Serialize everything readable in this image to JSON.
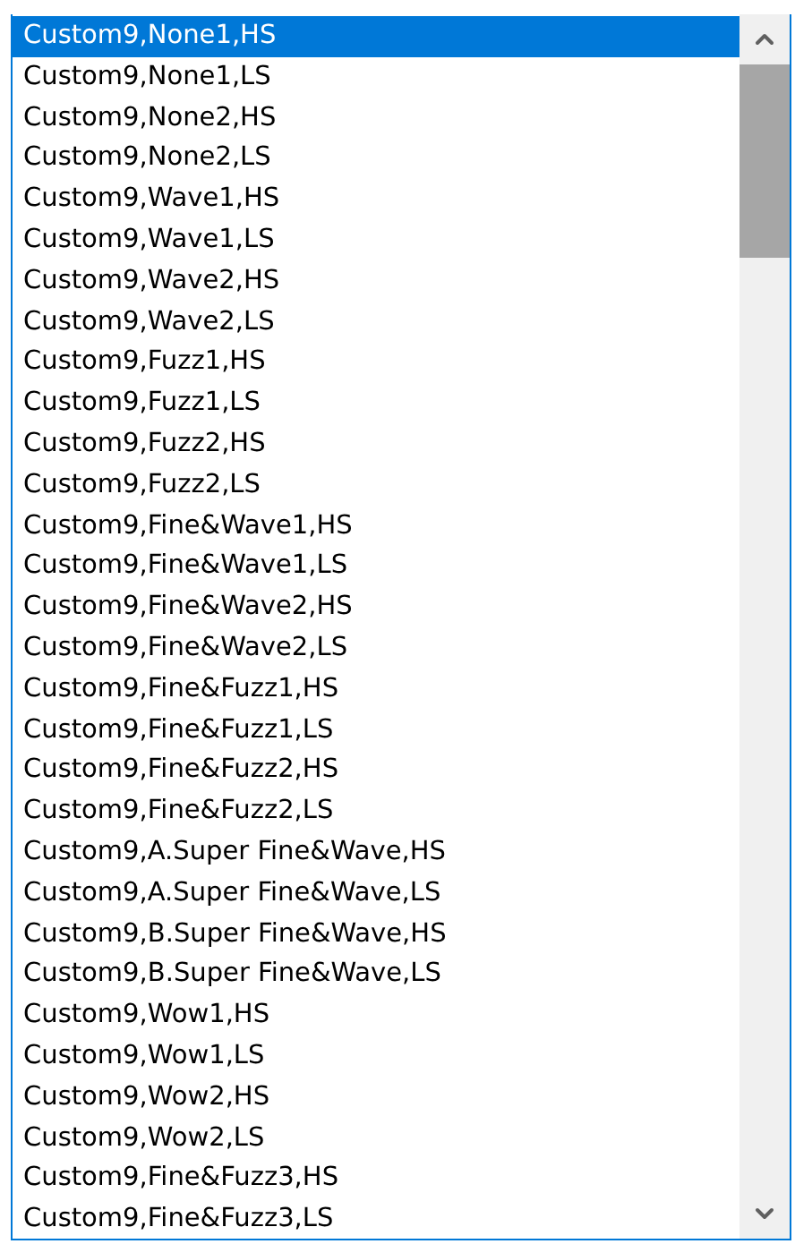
{
  "list": {
    "items": [
      {
        "label": "Custom9,None1,HS",
        "selected": true
      },
      {
        "label": "Custom9,None1,LS",
        "selected": false
      },
      {
        "label": "Custom9,None2,HS",
        "selected": false
      },
      {
        "label": "Custom9,None2,LS",
        "selected": false
      },
      {
        "label": "Custom9,Wave1,HS",
        "selected": false
      },
      {
        "label": "Custom9,Wave1,LS",
        "selected": false
      },
      {
        "label": "Custom9,Wave2,HS",
        "selected": false
      },
      {
        "label": "Custom9,Wave2,LS",
        "selected": false
      },
      {
        "label": "Custom9,Fuzz1,HS",
        "selected": false
      },
      {
        "label": "Custom9,Fuzz1,LS",
        "selected": false
      },
      {
        "label": "Custom9,Fuzz2,HS",
        "selected": false
      },
      {
        "label": "Custom9,Fuzz2,LS",
        "selected": false
      },
      {
        "label": "Custom9,Fine&Wave1,HS",
        "selected": false
      },
      {
        "label": "Custom9,Fine&Wave1,LS",
        "selected": false
      },
      {
        "label": "Custom9,Fine&Wave2,HS",
        "selected": false
      },
      {
        "label": "Custom9,Fine&Wave2,LS",
        "selected": false
      },
      {
        "label": "Custom9,Fine&Fuzz1,HS",
        "selected": false
      },
      {
        "label": "Custom9,Fine&Fuzz1,LS",
        "selected": false
      },
      {
        "label": "Custom9,Fine&Fuzz2,HS",
        "selected": false
      },
      {
        "label": "Custom9,Fine&Fuzz2,LS",
        "selected": false
      },
      {
        "label": "Custom9,A.Super Fine&Wave,HS",
        "selected": false
      },
      {
        "label": "Custom9,A.Super Fine&Wave,LS",
        "selected": false
      },
      {
        "label": "Custom9,B.Super Fine&Wave,HS",
        "selected": false
      },
      {
        "label": "Custom9,B.Super Fine&Wave,LS",
        "selected": false
      },
      {
        "label": "Custom9,Wow1,HS",
        "selected": false
      },
      {
        "label": "Custom9,Wow1,LS",
        "selected": false
      },
      {
        "label": "Custom9,Wow2,HS",
        "selected": false
      },
      {
        "label": "Custom9,Wow2,LS",
        "selected": false
      },
      {
        "label": "Custom9,Fine&Fuzz3,HS",
        "selected": false
      },
      {
        "label": "Custom9,Fine&Fuzz3,LS",
        "selected": false
      }
    ]
  }
}
